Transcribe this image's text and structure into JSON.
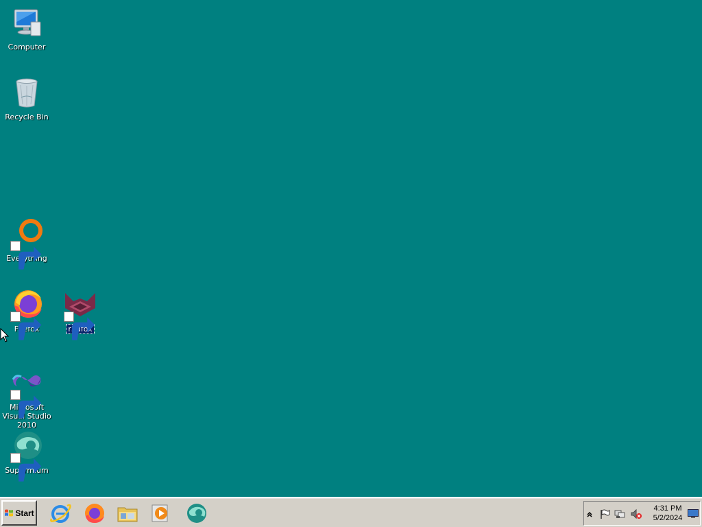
{
  "desktop": {
    "background": "#008080",
    "icons": [
      {
        "name": "computer",
        "label": "Computer",
        "icon": "computer-icon",
        "shortcut": false,
        "selected": false
      },
      {
        "name": "recycle-bin",
        "label": "Recycle Bin",
        "icon": "recycle-bin-icon",
        "shortcut": false,
        "selected": false
      },
      {
        "name": "everything",
        "label": "Everything",
        "icon": "everything-icon",
        "shortcut": true,
        "selected": false
      },
      {
        "name": "firefox",
        "label": "Firefox",
        "icon": "firefox-icon",
        "shortcut": true,
        "selected": false
      },
      {
        "name": "r3dfox",
        "label": "r3dfox",
        "icon": "r3dfox-icon",
        "shortcut": true,
        "selected": true
      },
      {
        "name": "visual-studio",
        "label": "Microsoft Visual Studio 2010",
        "icon": "visual-studio-icon",
        "shortcut": true,
        "selected": false
      },
      {
        "name": "supermium",
        "label": "Supermium",
        "icon": "supermium-icon",
        "shortcut": true,
        "selected": false
      }
    ]
  },
  "taskbar": {
    "start_label": "Start",
    "quick_launch": [
      {
        "name": "internet-explorer",
        "icon": "internet-explorer-icon"
      },
      {
        "name": "firefox",
        "icon": "firefox-icon"
      },
      {
        "name": "file-explorer",
        "icon": "folder-icon"
      },
      {
        "name": "media-player",
        "icon": "media-player-icon"
      },
      {
        "name": "supermium",
        "icon": "supermium-icon"
      }
    ],
    "tray": {
      "icons": [
        "show-hidden-icons-icon",
        "action-center-flag-icon",
        "network-icon",
        "volume-muted-icon"
      ],
      "time": "4:31 PM",
      "date": "5/2/2024"
    }
  }
}
